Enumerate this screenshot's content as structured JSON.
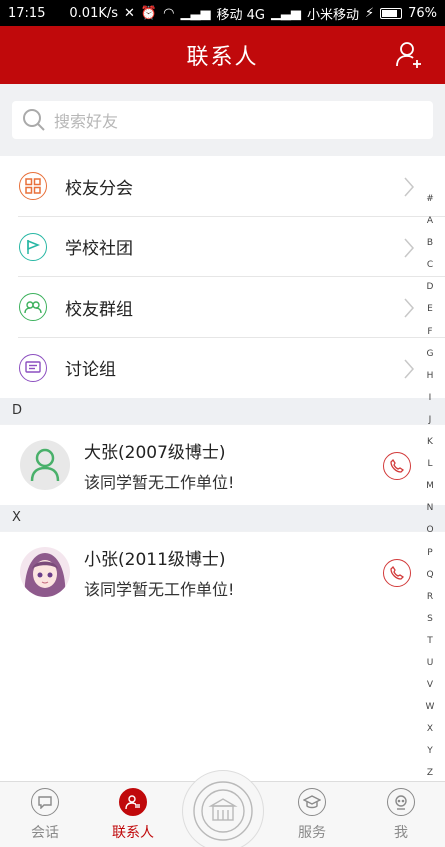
{
  "status": {
    "time": "17:15",
    "speed": "0.01K/s",
    "carrier1": "移动 4G",
    "carrier2": "小米移动",
    "battery": "76%"
  },
  "header": {
    "title": "联系人"
  },
  "search": {
    "placeholder": "搜索好友"
  },
  "menu": [
    {
      "label": "校友分会",
      "icon": "grid-icon",
      "color": "#e8703a"
    },
    {
      "label": "学校社团",
      "icon": "flag-icon",
      "color": "#27b7a4"
    },
    {
      "label": "校友群组",
      "icon": "group-icon",
      "color": "#3cb15c"
    },
    {
      "label": "讨论组",
      "icon": "chat-list-icon",
      "color": "#8c4fc0"
    }
  ],
  "sections": [
    {
      "letter": "D",
      "contacts": [
        {
          "name": "大张(2007级博士)",
          "org": "该同学暂无工作单位!"
        }
      ]
    },
    {
      "letter": "X",
      "contacts": [
        {
          "name": "小张(2011级博士)",
          "org": "该同学暂无工作单位!"
        }
      ]
    }
  ],
  "index": [
    "#",
    "A",
    "B",
    "C",
    "D",
    "E",
    "F",
    "G",
    "H",
    "I",
    "J",
    "K",
    "L",
    "M",
    "N",
    "O",
    "P",
    "Q",
    "R",
    "S",
    "T",
    "U",
    "V",
    "W",
    "X",
    "Y",
    "Z"
  ],
  "tabs": [
    {
      "label": "会话",
      "active": false
    },
    {
      "label": "联系人",
      "active": true
    },
    {
      "label": "服务",
      "active": false
    },
    {
      "label": "我",
      "active": false
    }
  ]
}
